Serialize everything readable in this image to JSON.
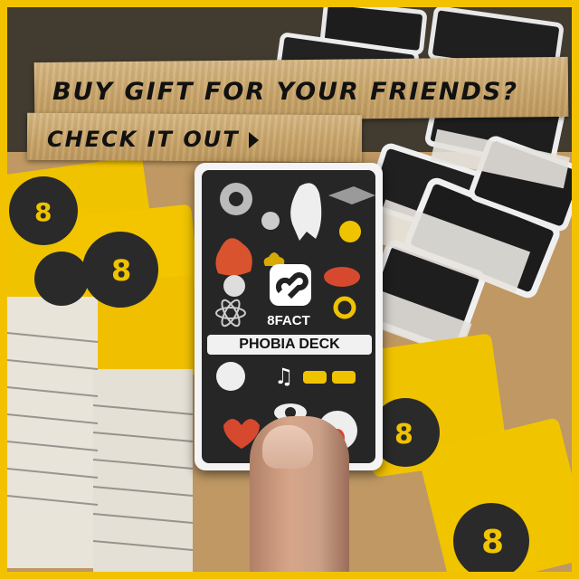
{
  "ad": {
    "headline": "BUY GIFT FOR YOUR FRIENDS?",
    "cta_label": "CHECK IT OUT"
  },
  "card": {
    "brand": "8FACT",
    "title": "PHOBIA DECK"
  },
  "colors": {
    "frame": "#f2c200",
    "tape": "#caa66b",
    "card_dark": "#262626",
    "card_yellow": "#f0c300"
  }
}
